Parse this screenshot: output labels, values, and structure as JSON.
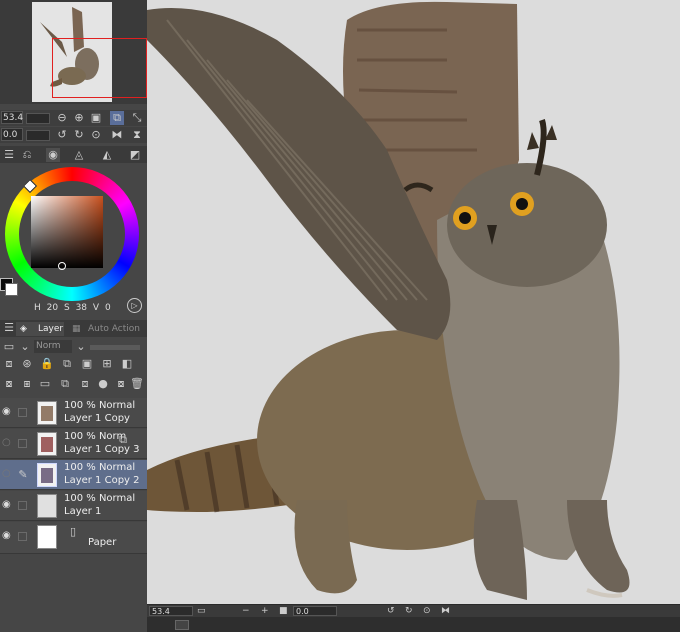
{
  "navigator": {
    "label": "navigator-thumbnail"
  },
  "toolbar": {
    "zoom_value": "53.4",
    "rotate_value": "0.0"
  },
  "color": {
    "h": "20",
    "s": "38",
    "v": "0",
    "h_label": "H",
    "s_label": "S",
    "v_label": "V",
    "accent": "#c8501e"
  },
  "layers_panel": {
    "tab_layer": "Layer",
    "tab_auto_action": "Auto Action",
    "blend_mode": "Norm",
    "layers": [
      {
        "opacity_mode": "100 % Normal",
        "name": "Layer 1 Copy"
      },
      {
        "opacity_mode": "100 % Norm",
        "name": "Layer 1 Copy 3"
      },
      {
        "opacity_mode": "100 % Normal",
        "name": "Layer 1 Copy 2"
      },
      {
        "opacity_mode": "100 % Normal",
        "name": "Layer 1"
      },
      {
        "name": "Paper"
      }
    ]
  },
  "canvas_bottom": {
    "zoom_value": "53.4",
    "rotate_value": "0.0"
  }
}
